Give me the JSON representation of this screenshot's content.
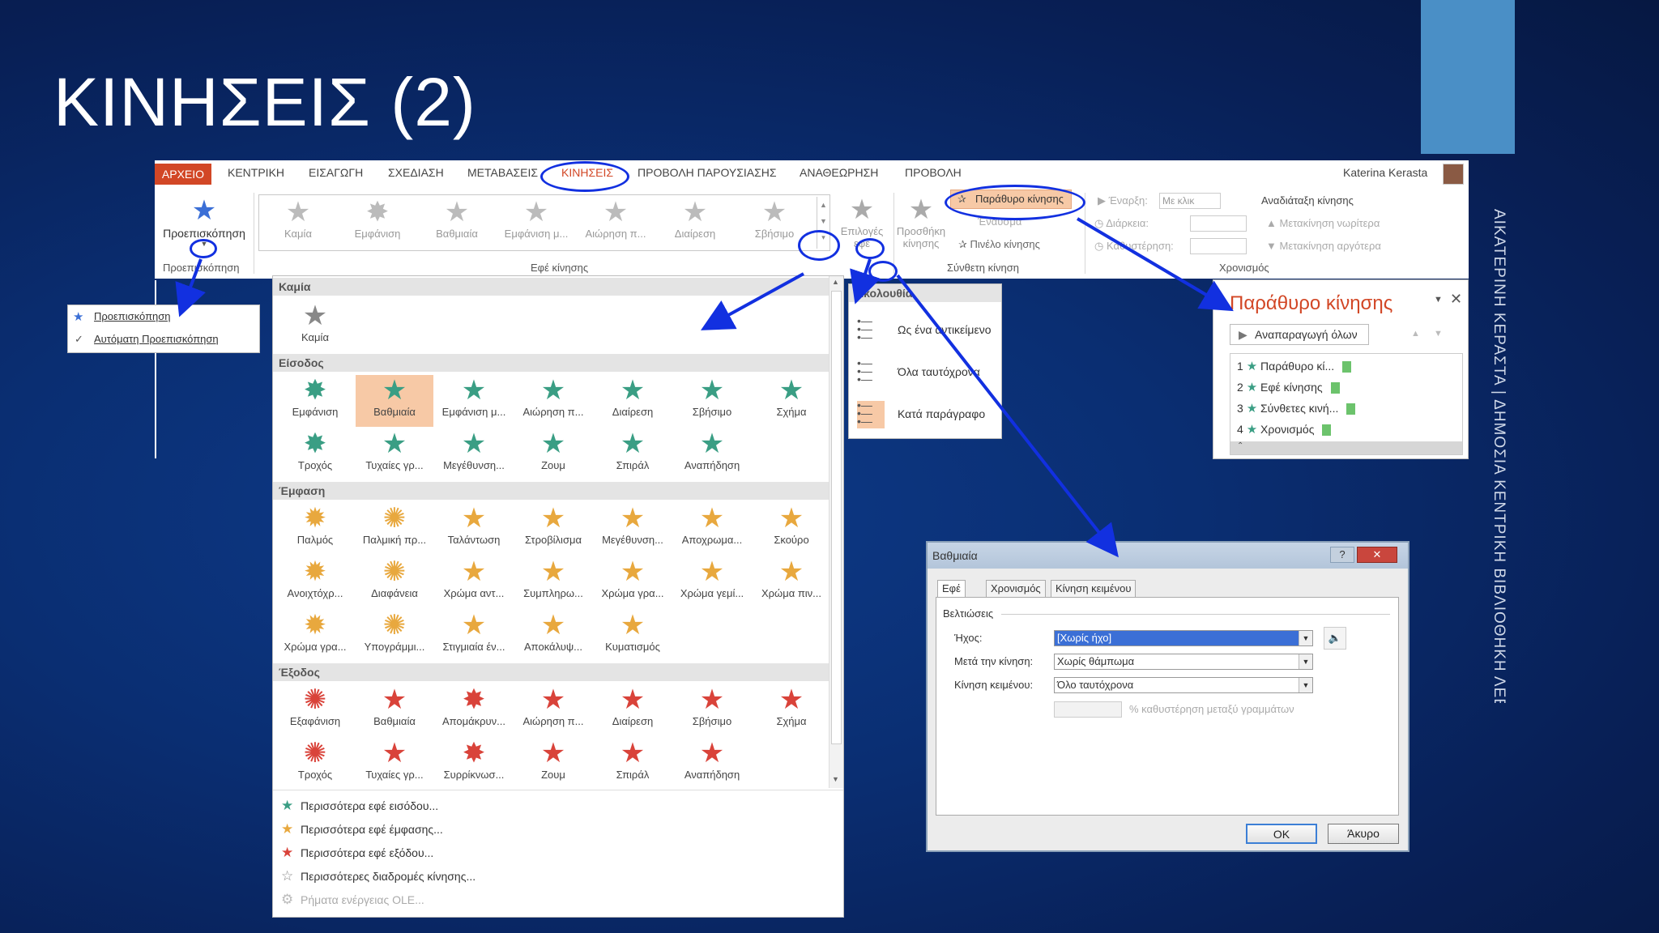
{
  "slide": {
    "title": "ΚΙΝΗΣΕΙΣ (2)",
    "side_text": "ΑΙΚΑΤΕΡΙΝΗ ΚΕΡΑΣΤΑ | ΔΗΜΟΣΙΑ ΚΕΝΤΡΙΚΗ ΒΙΒΛΙΟΘΗΚΗ ΛΕΒΑΔΕΙΑΣ"
  },
  "ribbon": {
    "tabs": [
      "ΑΡΧΕΙΟ",
      "ΚΕΝΤΡΙΚΗ",
      "ΕΙΣΑΓΩΓΗ",
      "ΣΧΕΔΙΑΣΗ",
      "ΜΕΤΑΒΑΣΕΙΣ",
      "ΚΙΝΗΣΕΙΣ",
      "ΠΡΟΒΟΛΗ ΠΑΡΟΥΣΙΑΣΗΣ",
      "ΑΝΑΘΕΩΡΗΣΗ",
      "ΠΡΟΒΟΛΗ"
    ],
    "user": "Katerina Kerasta",
    "preview_button": "Προεπισκόπηση",
    "group_preview": "Προεπισκόπηση",
    "group_effects": "Εφέ κίνησης",
    "group_advanced": "Σύνθετη κίνηση",
    "group_timing": "Χρονισμός",
    "gallery": [
      "Καμία",
      "Εμφάνιση",
      "Βαθμιαία",
      "Εμφάνιση μ...",
      "Αιώρηση π...",
      "Διαίρεση",
      "Σβήσιμο"
    ],
    "effect_options": "Επιλογές εφέ",
    "add_animation": "Προσθήκη κίνησης",
    "animation_pane": "Παράθυρο κίνησης",
    "trigger": "Έναυσμα",
    "painter": "Πινέλο κίνησης",
    "start_label": "Έναρξη:",
    "start_value": "Με κλικ",
    "duration_label": "Διάρκεια:",
    "delay_label": "Καθυστέρηση:",
    "reorder": "Αναδιάταξη κίνησης",
    "move_earlier": "Μετακίνηση νωρίτερα",
    "move_later": "Μετακίνηση αργότερα"
  },
  "preview_menu": [
    "Προεπισκόπηση",
    "Αυτόματη Προεπισκόπηση"
  ],
  "gallery_dropdown": {
    "none_header": "Καμία",
    "none_item": "Καμία",
    "entrance_header": "Είσοδος",
    "entrance": [
      "Εμφάνιση",
      "Βαθμιαία",
      "Εμφάνιση μ...",
      "Αιώρηση π...",
      "Διαίρεση",
      "Σβήσιμο",
      "Σχήμα",
      "Τροχός",
      "Τυχαίες γρ...",
      "Μεγέθυνση...",
      "Ζουμ",
      "Σπιράλ",
      "Αναπήδηση"
    ],
    "emphasis_header": "Έμφαση",
    "emphasis": [
      "Παλμός",
      "Παλμική πρ...",
      "Ταλάντωση",
      "Στροβίλισμα",
      "Μεγέθυνση...",
      "Αποχρωμα...",
      "Σκούρο",
      "Ανοιχτόχρ...",
      "Διαφάνεια",
      "Χρώμα αντ...",
      "Συμπληρω...",
      "Χρώμα γρα...",
      "Χρώμα γεμί...",
      "Χρώμα πιν...",
      "Χρώμα γρα...",
      "Υπογράμμι...",
      "Στιγμιαία έν...",
      "Αποκάλυψ...",
      "Κυματισμός"
    ],
    "exit_header": "Έξοδος",
    "exit": [
      "Εξαφάνιση",
      "Βαθμιαία",
      "Απομάκρυν...",
      "Αιώρηση π...",
      "Διαίρεση",
      "Σβήσιμο",
      "Σχήμα",
      "Τροχός",
      "Τυχαίες γρ...",
      "Συρρίκνωσ...",
      "Ζουμ",
      "Σπιράλ",
      "Αναπήδηση"
    ],
    "more": [
      "Περισσότερα εφέ εισόδου...",
      "Περισσότερα εφέ έμφασης...",
      "Περισσότερα εφέ εξόδου...",
      "Περισσότερες διαδρομές κίνησης...",
      "Ρήματα ενέργειας OLE..."
    ]
  },
  "sequence_menu": {
    "header": "Ακολουθία",
    "items": [
      "Ως ένα αντικείμενο",
      "Όλα ταυτόχρονα",
      "Κατά παράγραφο"
    ]
  },
  "animation_pane": {
    "title": "Παράθυρο κίνησης",
    "play_all": "Αναπαραγωγή όλων",
    "rows": [
      {
        "num": "1",
        "label": "Παράθυρο κί..."
      },
      {
        "num": "2",
        "label": "Εφέ κίνησης"
      },
      {
        "num": "3",
        "label": "Σύνθετες κινή..."
      },
      {
        "num": "4",
        "label": "Χρονισμός"
      }
    ]
  },
  "dialog": {
    "title": "Βαθμιαία",
    "tabs": [
      "Εφέ",
      "Χρονισμός",
      "Κίνηση κειμένου"
    ],
    "section": "Βελτιώσεις",
    "sound_label": "Ήχος:",
    "sound_value": "[Χωρίς ήχο]",
    "after_label": "Μετά την κίνηση:",
    "after_value": "Χωρίς θάμπωμα",
    "text_label": "Κίνηση κειμένου:",
    "text_value": "Όλο ταυτόχρονα",
    "delay_text": "% καθυστέρηση μεταξύ γραμμάτων",
    "ok": "OK",
    "cancel": "Άκυρο"
  },
  "colors": {
    "accent": "#d24726",
    "entrance": "#3a9e84",
    "emphasis": "#e8a83e",
    "exit": "#d9433a",
    "arrow": "#1230e0"
  }
}
